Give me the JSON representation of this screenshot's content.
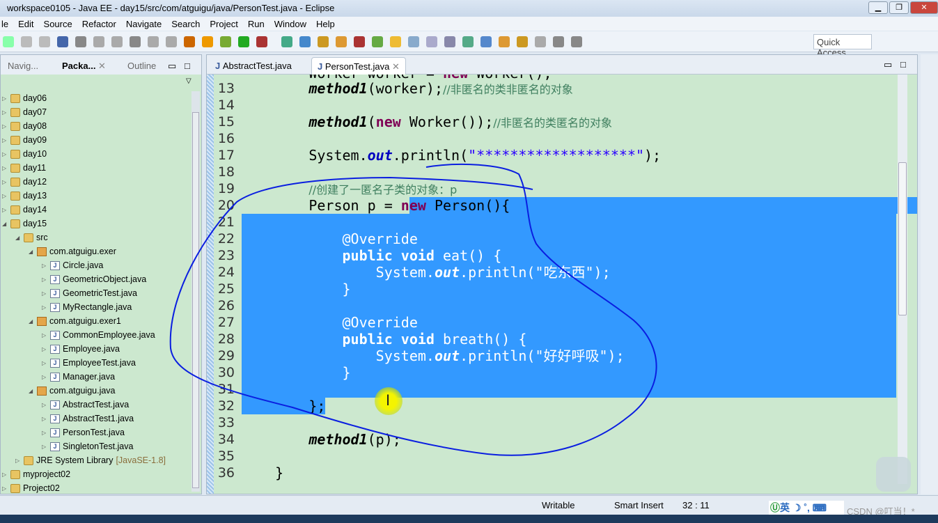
{
  "window": {
    "title": "workspace0105 - Java EE - day15/src/com/atguigu/java/PersonTest.java - Eclipse"
  },
  "menu": [
    "le",
    "Edit",
    "Source",
    "Refactor",
    "Navigate",
    "Search",
    "Project",
    "Run",
    "Window",
    "Help"
  ],
  "toolbar": {
    "quick_access": "Quick Access"
  },
  "left_panel": {
    "tabs": [
      "Navig...",
      "Packa...",
      "Outline"
    ],
    "tree": [
      {
        "label": "day06",
        "depth": 0,
        "type": "folder",
        "twisty": "▷"
      },
      {
        "label": "day07",
        "depth": 0,
        "type": "folder",
        "twisty": "▷"
      },
      {
        "label": "day08",
        "depth": 0,
        "type": "folder",
        "twisty": "▷"
      },
      {
        "label": "day09",
        "depth": 0,
        "type": "folder",
        "twisty": "▷"
      },
      {
        "label": "day10",
        "depth": 0,
        "type": "folder",
        "twisty": "▷"
      },
      {
        "label": "day11",
        "depth": 0,
        "type": "folder",
        "twisty": "▷"
      },
      {
        "label": "day12",
        "depth": 0,
        "type": "folder",
        "twisty": "▷"
      },
      {
        "label": "day13",
        "depth": 0,
        "type": "folder",
        "twisty": "▷"
      },
      {
        "label": "day14",
        "depth": 0,
        "type": "folder",
        "twisty": "▷"
      },
      {
        "label": "day15",
        "depth": 0,
        "type": "folder",
        "twisty": "◢"
      },
      {
        "label": "src",
        "depth": 1,
        "type": "folder",
        "twisty": "◢"
      },
      {
        "label": "com.atguigu.exer",
        "depth": 2,
        "type": "pkg",
        "twisty": "◢"
      },
      {
        "label": "Circle.java",
        "depth": 3,
        "type": "java",
        "twisty": "▷"
      },
      {
        "label": "GeometricObject.java",
        "depth": 3,
        "type": "java",
        "twisty": "▷"
      },
      {
        "label": "GeometricTest.java",
        "depth": 3,
        "type": "java",
        "twisty": "▷"
      },
      {
        "label": "MyRectangle.java",
        "depth": 3,
        "type": "java",
        "twisty": "▷"
      },
      {
        "label": "com.atguigu.exer1",
        "depth": 2,
        "type": "pkg",
        "twisty": "◢"
      },
      {
        "label": "CommonEmployee.java",
        "depth": 3,
        "type": "java",
        "twisty": "▷"
      },
      {
        "label": "Employee.java",
        "depth": 3,
        "type": "java",
        "twisty": "▷"
      },
      {
        "label": "EmployeeTest.java",
        "depth": 3,
        "type": "java",
        "twisty": "▷"
      },
      {
        "label": "Manager.java",
        "depth": 3,
        "type": "java",
        "twisty": "▷"
      },
      {
        "label": "com.atguigu.java",
        "depth": 2,
        "type": "pkg",
        "twisty": "◢"
      },
      {
        "label": "AbstractTest.java",
        "depth": 3,
        "type": "java",
        "twisty": "▷"
      },
      {
        "label": "AbstractTest1.java",
        "depth": 3,
        "type": "java",
        "twisty": "▷"
      },
      {
        "label": "PersonTest.java",
        "depth": 3,
        "type": "java",
        "twisty": "▷"
      },
      {
        "label": "SingletonTest.java",
        "depth": 3,
        "type": "java",
        "twisty": "▷"
      },
      {
        "label": "JRE System Library",
        "suffix": "[JavaSE-1.8]",
        "depth": 1,
        "type": "lib",
        "twisty": "▷"
      },
      {
        "label": "myproject02",
        "depth": 0,
        "type": "folder",
        "twisty": "▷"
      },
      {
        "label": "Project02",
        "depth": 0,
        "type": "folder",
        "twisty": "▷"
      }
    ]
  },
  "editor": {
    "tabs": [
      "AbstractTest.java",
      "PersonTest.java"
    ],
    "active_tab": 1,
    "lines": [
      {
        "n": "13",
        "html": "        <span class='it'>method1</span>(worker);<span class='cm'>//非匿名的类非匿名的对象</span>"
      },
      {
        "n": "14",
        "html": ""
      },
      {
        "n": "15",
        "html": "        <span class='it'>method1</span>(<span class='kw'>new</span> Worker());<span class='cm'>//非匿名的类匿名的对象</span>"
      },
      {
        "n": "16",
        "html": ""
      },
      {
        "n": "17",
        "html": "        System.<span class='fld'>out</span>.println(<span class='str'>\"*******************\"</span>);"
      },
      {
        "n": "18",
        "html": ""
      },
      {
        "n": "19",
        "html": "        <span class='cm'>//创建了一匿名子类的对象：p</span>"
      },
      {
        "n": "20",
        "html": "        Person p = <span class='kw'>new</span> Person(){"
      },
      {
        "n": "21",
        "html": ""
      },
      {
        "n": "22",
        "html": "            <span class='ann'>@Override</span>"
      },
      {
        "n": "23",
        "html": "            <span class='kw'>public</span> <span class='kw'>void</span> eat() {"
      },
      {
        "n": "24",
        "html": "                System.<span class='fld'>out</span>.println(<span class='str'>\"吃东西\"</span>);"
      },
      {
        "n": "25",
        "html": "            }"
      },
      {
        "n": "26",
        "html": ""
      },
      {
        "n": "27",
        "html": "            <span class='ann'>@Override</span>"
      },
      {
        "n": "28",
        "html": "            <span class='kw'>public</span> <span class='kw'>void</span> breath() {"
      },
      {
        "n": "29",
        "html": "                System.<span class='fld'>out</span>.println(<span class='str'>\"好好呼吸\"</span>);"
      },
      {
        "n": "30",
        "html": "            }"
      },
      {
        "n": "31",
        "html": ""
      },
      {
        "n": "32",
        "html": "        };"
      },
      {
        "n": "33",
        "html": ""
      },
      {
        "n": "34",
        "html": "        <span class='it'>method1</span>(p);"
      },
      {
        "n": "35",
        "html": ""
      },
      {
        "n": "36",
        "html": "    }"
      }
    ],
    "selection": {
      "start": "20:12",
      "end": "32:11"
    }
  },
  "status": {
    "writable": "Writable",
    "insert_mode": "Smart Insert",
    "position": "32 : 11"
  },
  "ime": {
    "label": "英"
  },
  "watermark": "CSDN @叮当！*",
  "colors": {
    "editor_bg": "#cce8cf",
    "selection": "#3399ff",
    "annotation_pen": "#0a1ee0"
  }
}
